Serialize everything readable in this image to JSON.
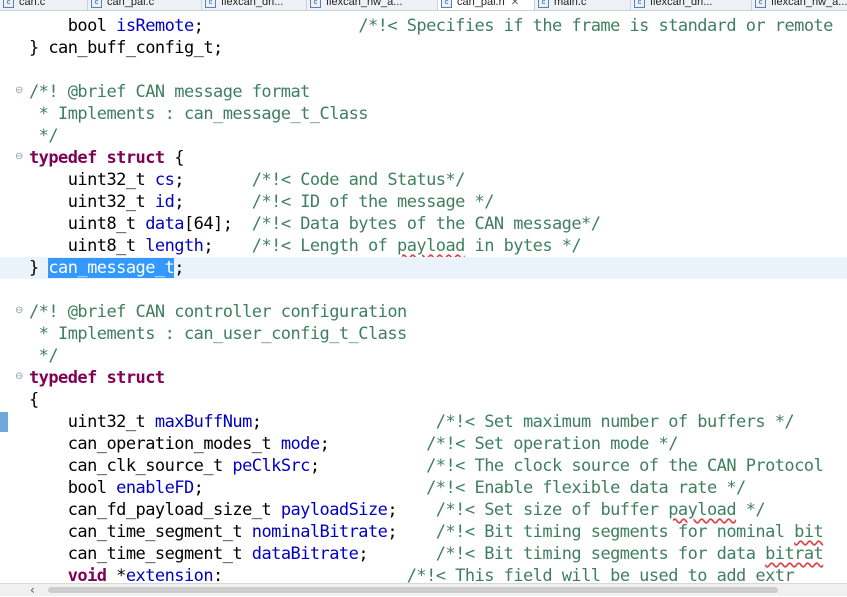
{
  "tabs": [
    {
      "label": "can.c",
      "active": false
    },
    {
      "label": "can_pal.c",
      "active": false
    },
    {
      "label": "flexcan_dri...",
      "active": false
    },
    {
      "label": "flexcan_hw_a...",
      "active": false
    },
    {
      "label": "can_pal.h",
      "active": true,
      "close": "✕"
    },
    {
      "label": "main.c",
      "active": false
    },
    {
      "label": "flexcan_dri...",
      "active": false
    },
    {
      "label": "flexcan_hw_a...",
      "active": false
    }
  ],
  "file_icon_glyph": "c",
  "colors": {
    "keyword": "#7f0055",
    "comment": "#3f7f5f",
    "variable": "#0000c0",
    "selection": "#3399ff",
    "current_line": "#eaf2fc"
  },
  "code": {
    "l01": {
      "a": "    bool ",
      "b": "isRemote",
      "c": ";                ",
      "d": "/*!< Specifies if the frame is standard or remote"
    },
    "l02": {
      "a": "} can_buff_config_t;"
    },
    "l04": {
      "a": "/*! @brief CAN message format"
    },
    "l05": {
      "a": " * Implements : can_message_t_Class"
    },
    "l06": {
      "a": " */"
    },
    "l07": {
      "kw": "typedef struct",
      "a": " {"
    },
    "l08": {
      "a": "    uint32_t ",
      "b": "cs",
      "c": ";       ",
      "d": "/*!< Code and Status*/"
    },
    "l09": {
      "a": "    uint32_t ",
      "b": "id",
      "c": ";       ",
      "d": "/*!< ID of the message */"
    },
    "l10": {
      "a": "    uint8_t ",
      "b": "data",
      "c": "[64];  ",
      "d": "/*!< Data bytes of the CAN message*/"
    },
    "l11": {
      "a": "    uint8_t ",
      "b": "length",
      "c": ";    ",
      "d": "/*!< Length of ",
      "e": "payload",
      "f": " in bytes */"
    },
    "l12": {
      "a": "} ",
      "sel": "can_message_t",
      "c": ";"
    },
    "l14": {
      "a": "/*! @brief CAN controller configuration"
    },
    "l15": {
      "a": " * Implements : can_user_config_t_Class"
    },
    "l16": {
      "a": " */"
    },
    "l17": {
      "kw": "typedef struct"
    },
    "l18": {
      "a": "{"
    },
    "l19": {
      "a": "    uint32_t ",
      "b": "maxBuffNum",
      "c": ";                  ",
      "d": "/*!< Set maximum number of buffers */"
    },
    "l20": {
      "a": "    can_operation_modes_t ",
      "b": "mode",
      "c": ";          ",
      "d": "/*!< Set operation mode */"
    },
    "l21": {
      "a": "    can_clk_source_t ",
      "b": "peClkSrc",
      "c": ";           ",
      "d": "/*!< The clock source of the CAN Protocol"
    },
    "l22": {
      "a": "    bool ",
      "b": "enableFD",
      "c": ";                       ",
      "d": "/*!< Enable flexible data rate */"
    },
    "l23": {
      "a": "    can_fd_payload_size_t ",
      "b": "payloadSize",
      "c": ";    ",
      "d": "/*!< Set size of buffer ",
      "e": "payload",
      "f": " */"
    },
    "l24": {
      "a": "    can_time_segment_t ",
      "b": "nominalBitrate",
      "c": ";    ",
      "d": "/*!< Bit timing segments for nominal ",
      "e": "bit"
    },
    "l25": {
      "a": "    can_time_segment_t ",
      "b": "dataBitrate",
      "c": ";       ",
      "d": "/*!< Bit timing segments for data ",
      "e": "bitrat"
    },
    "l26": {
      "kw": "void",
      "a": " *",
      "b": "extension",
      "c": ":                   ",
      "d": "/*!< This field will be used to add extr"
    }
  },
  "fold_glyph": "⊖",
  "scroll_left_arrow": "‹"
}
